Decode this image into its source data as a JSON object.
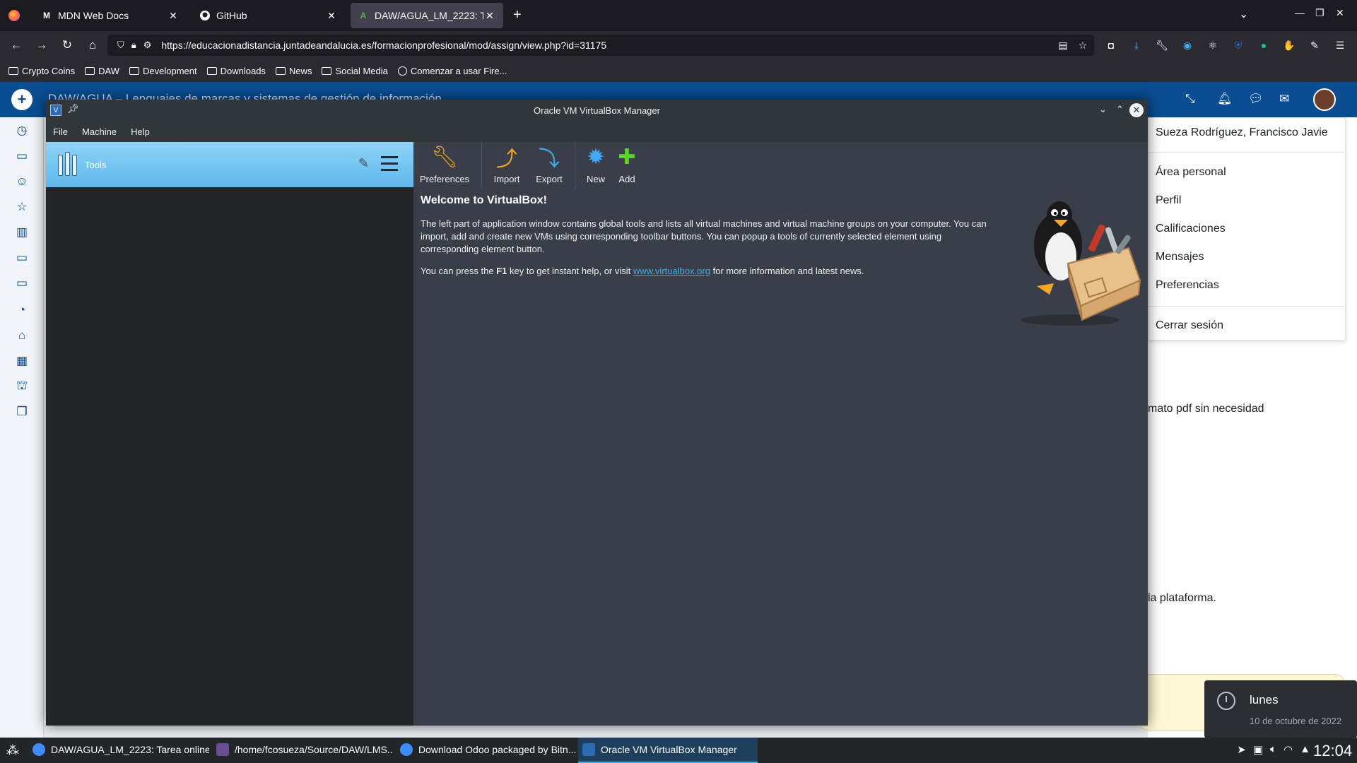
{
  "browser": {
    "tabs": [
      {
        "label": "MDN Web Docs",
        "favicon": "M"
      },
      {
        "label": "GitHub",
        "favicon": "github-icon"
      },
      {
        "label": "DAW/AGUA_LM_2223: Tarea online",
        "favicon": "A"
      }
    ],
    "url": "https://educacionadistancia.juntadeandalucia.es/formacionprofesional/mod/assign/view.php?id=31175",
    "bookmarks": [
      "Crypto Coins",
      "DAW",
      "Development",
      "Downloads",
      "News",
      "Social Media",
      "Comenzar a usar Fire..."
    ]
  },
  "moodle": {
    "header_title": "DAW/AGUA – Lenguajes de marcas y sistemas de gestión de información",
    "user_name": "Sueza Rodríguez, Francisco Javie",
    "user_menu": [
      "Área personal",
      "Perfil",
      "Calificaciones",
      "Mensajes",
      "Preferencias"
    ],
    "logout": "Cerrar sesión",
    "page_text_1": "mato pdf sin necesidad",
    "page_text_2": "la plataforma."
  },
  "vbox": {
    "title": "Oracle VM VirtualBox Manager",
    "menu": [
      "File",
      "Machine",
      "Help"
    ],
    "tools_label": "Tools",
    "toolbar": [
      "Preferences",
      "Import",
      "Export",
      "New",
      "Add"
    ],
    "welcome_title": "Welcome to VirtualBox!",
    "welcome_p1": "The left part of application window contains global tools and lists all virtual machines and virtual machine groups on your computer. You can import, add and create new VMs using corresponding toolbar buttons. You can popup a tools of currently selected element using corresponding element button.",
    "welcome_p2_before": "You can press the ",
    "welcome_p2_key": "F1",
    "welcome_p2_middle": " key to get instant help, or visit ",
    "welcome_link": "www.virtualbox.org",
    "welcome_p2_after": " for more information and latest news."
  },
  "notification": {
    "title": "lunes",
    "body": "10 de octubre de 2022"
  },
  "taskbar": {
    "tasks": [
      "DAW/AGUA_LM_2223: Tarea online...",
      "/home/fcosueza/Source/DAW/LMS...",
      "Download Odoo packaged by Bitn...",
      "Oracle VM VirtualBox Manager"
    ],
    "clock": "12:04"
  },
  "colors": {
    "accent": "#3daee9",
    "moodle_blue": "#0a4d91",
    "tools_highlight": "#5fb8eb"
  }
}
